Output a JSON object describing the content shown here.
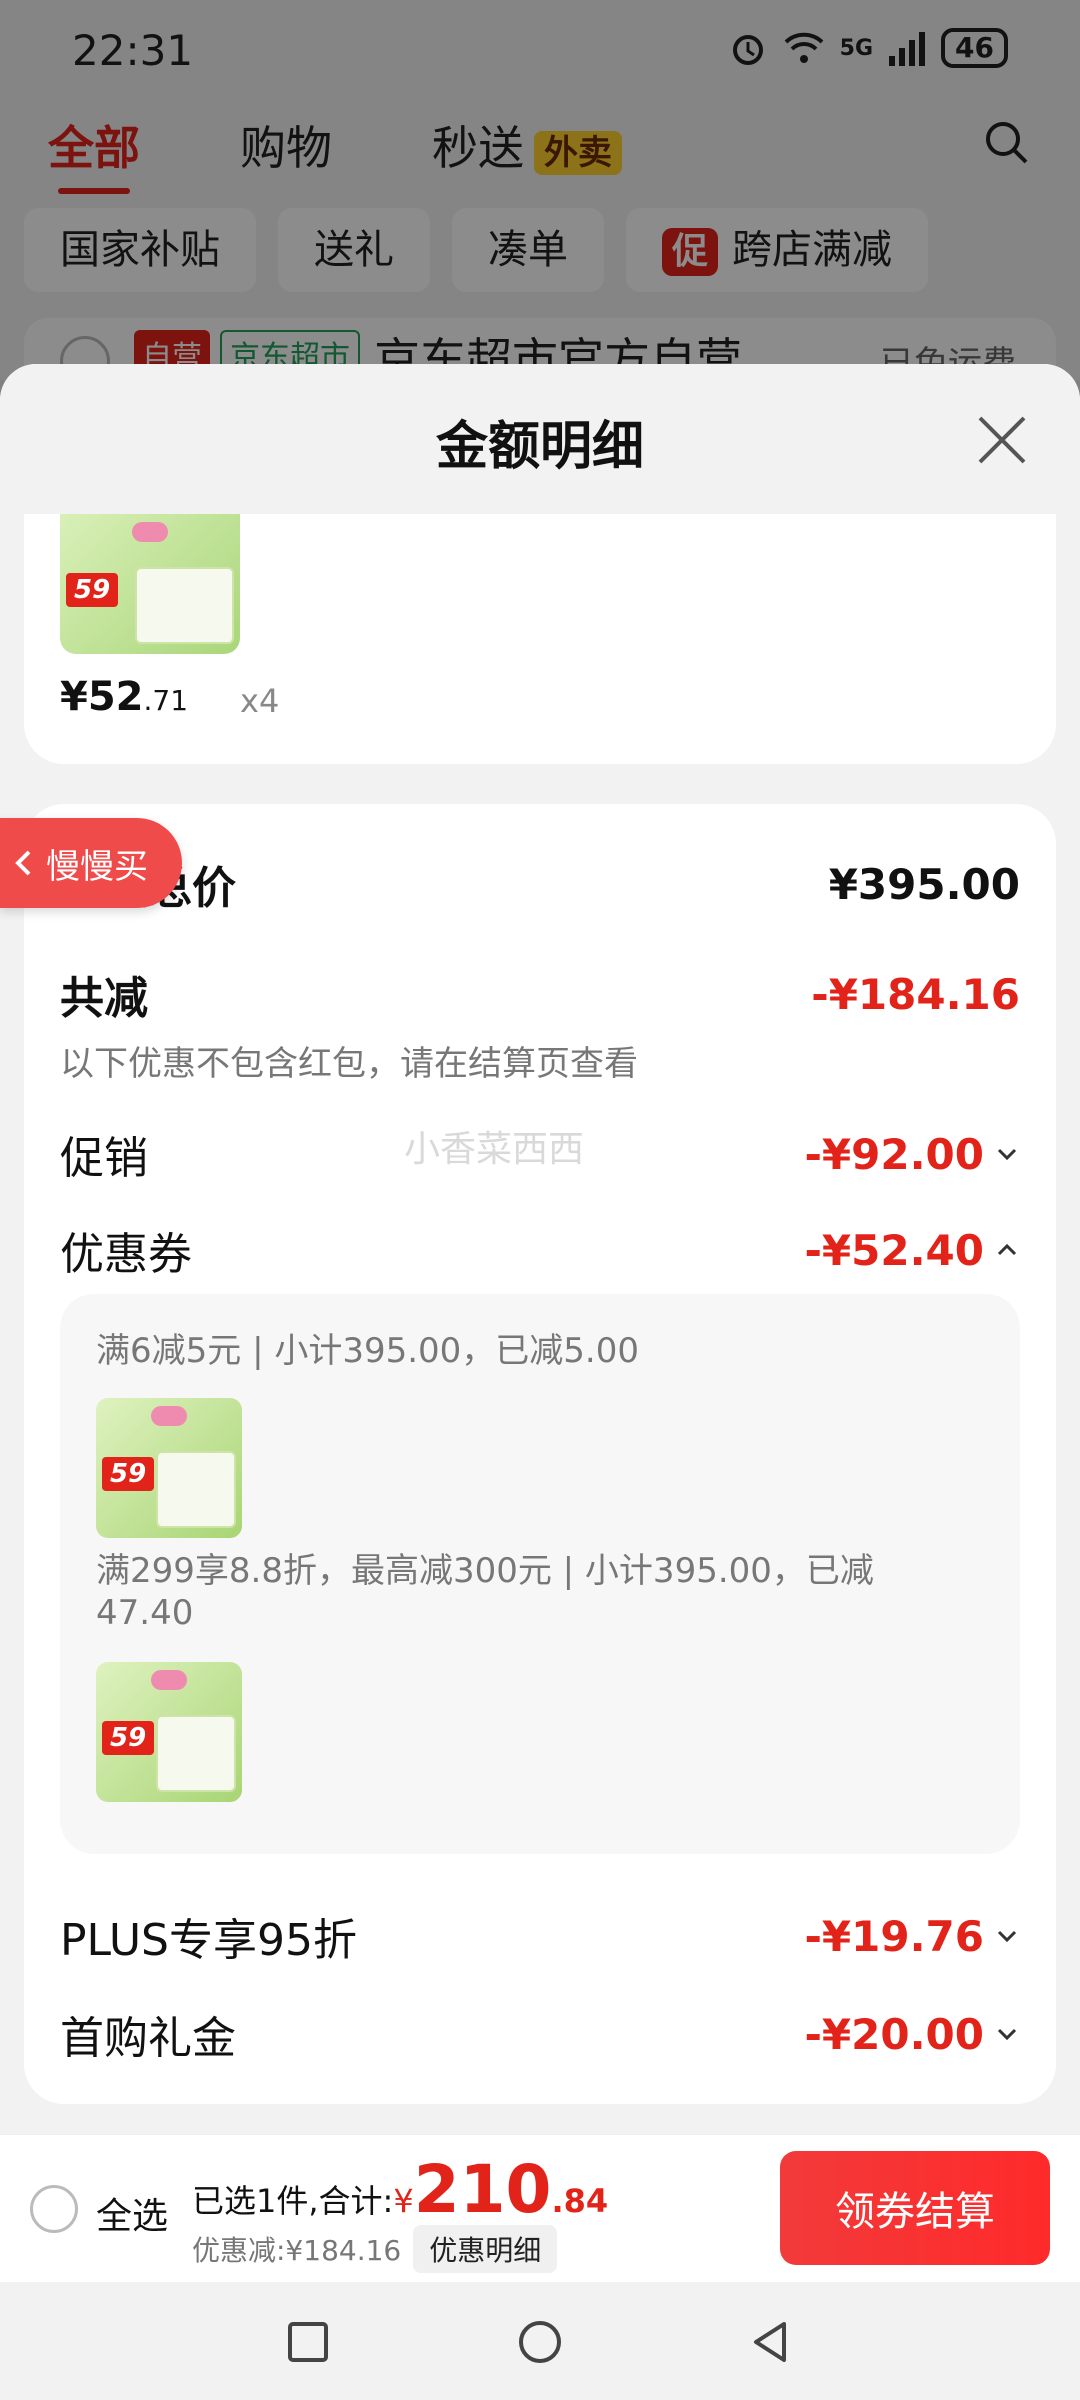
{
  "status": {
    "time": "22:31",
    "signal": "5G",
    "wifi": "6",
    "battery": "46"
  },
  "top_tabs": [
    {
      "label": "全部",
      "active": true
    },
    {
      "label": "购物",
      "active": false
    },
    {
      "label": "秒送",
      "active": false,
      "badge": "外卖"
    }
  ],
  "chips": [
    "国家补贴",
    "送礼",
    "凑单",
    "跨店满减"
  ],
  "chip_promo_mark": "促",
  "store": {
    "tag_self": "自营",
    "tag_market": "京东超市",
    "name": "京东超市官方自营",
    "shipping": "已免运费"
  },
  "sheet": {
    "title": "金额明细",
    "product": {
      "price_int": "¥52",
      "price_dec": ".71",
      "qty": "x4",
      "thumb_tag": "59"
    },
    "total_label": "商品总价",
    "total_value": "¥395.00",
    "reduce_label": "共减",
    "reduce_value": "-¥184.16",
    "note": "以下优惠不包含红包，请在结算页查看",
    "watermark": "小香菜西西",
    "promo_label": "促销",
    "promo_value": "-¥92.00",
    "coupon_label": "优惠券",
    "coupon_value": "-¥52.40",
    "coupon_details": [
      {
        "text": "满6减5元 | 小计395.00，已减5.00",
        "thumb_tag": "59"
      },
      {
        "text": "满299享8.8折，最高减300元 | 小计395.00，已减47.40",
        "thumb_tag": "59"
      }
    ],
    "plus_label": "PLUS专享95折",
    "plus_value": "-¥19.76",
    "first_label": "首购礼金",
    "first_value": "-¥20.00"
  },
  "float_btn": "慢慢买",
  "bottom": {
    "select_all": "全选",
    "summary_prefix": "已选1件,合计:",
    "currency": "¥",
    "amount_int": "210",
    "amount_dec": ".84",
    "discount": "优惠减:¥184.16",
    "detail_btn": "优惠明细",
    "checkout": "领券结算"
  },
  "colors": {
    "accent": "#e2231a",
    "bg": "#f2f2f2"
  }
}
